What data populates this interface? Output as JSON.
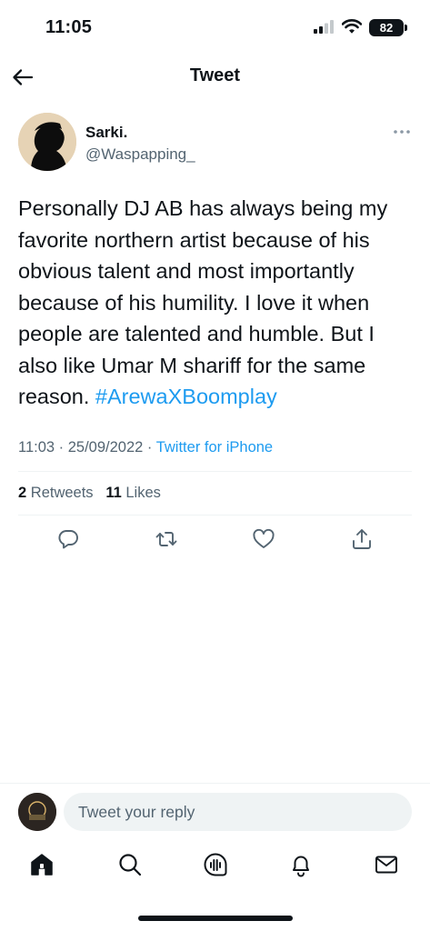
{
  "status_bar": {
    "time": "11:05",
    "battery": "82"
  },
  "header": {
    "title": "Tweet",
    "back_icon": "arrow-left-icon"
  },
  "tweet": {
    "author_name": "Sarki.",
    "author_handle": "@Waspapping_",
    "body_text": "Personally DJ AB has always being my favorite northern artist because of his obvious talent and most importantly because of his humility. I love it when people are talented and humble. But I also like Umar M shariff for the same reason. ",
    "hashtag": "#ArewaXBoomplay",
    "time": "11:03",
    "date": "25/09/2022",
    "source": "Twitter for iPhone",
    "retweets_count": "2",
    "retweets_label": "Retweets",
    "likes_count": "11",
    "likes_label": "Likes"
  },
  "actions": [
    "reply-icon",
    "retweet-icon",
    "like-icon",
    "share-icon"
  ],
  "reply_bar": {
    "placeholder": "Tweet your reply"
  },
  "bottom_nav": [
    "home-icon",
    "search-icon",
    "spaces-icon",
    "notifications-icon",
    "messages-icon"
  ],
  "colors": {
    "accent": "#1d9bf0",
    "text": "#0f1419",
    "secondary": "#536471",
    "divider": "#eff3f4"
  }
}
